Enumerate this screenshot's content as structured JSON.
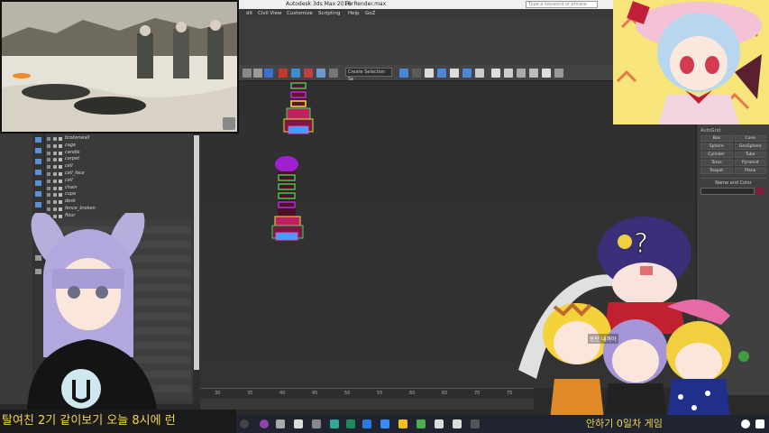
{
  "app": {
    "title": "Autodesk 3ds Max 2016",
    "file": "ForRender.max",
    "search_placeholder": "Type a keyword or phrase"
  },
  "menu": [
    "dit",
    "Civil View",
    "Customize",
    "Scripting",
    "Help",
    "GoZ"
  ],
  "toolbar": {
    "selection_filter": "Create Selection Se"
  },
  "scene_explorer": {
    "items": [
      "brokenwall",
      "cage",
      "candle",
      "carpet",
      "cell",
      "cell_face",
      "cell",
      "chain",
      "cupe",
      "desk",
      "fence_broken",
      "floor"
    ]
  },
  "command_panel": {
    "rollout": "AutoGrid",
    "buttons": [
      "Box",
      "Cone",
      "Sphere",
      "GeoSphere",
      "Cylinder",
      "Tube",
      "Torus",
      "Pyramid",
      "Teapot",
      "Plane"
    ],
    "name_color_header": "Name and Color",
    "swatch_color": "#8a1a3a"
  },
  "timeline": {
    "ticks": [
      "30",
      "35",
      "40",
      "45",
      "50",
      "55",
      "60",
      "65",
      "70",
      "75"
    ]
  },
  "overlay_text": {
    "ticker_left": "여친 2기 같이보기   오늘 8시에 런",
    "ticker_left_partial": "탈여친 2기 같이보기   오늘 8시에 런",
    "ticker_right": "안하기 0일차 게임",
    "chat": "동탄 내꺼야"
  },
  "colors": {
    "accent_yellow": "#f4d44d",
    "viewport_bg": "#333333",
    "panel_bg": "#404040"
  }
}
